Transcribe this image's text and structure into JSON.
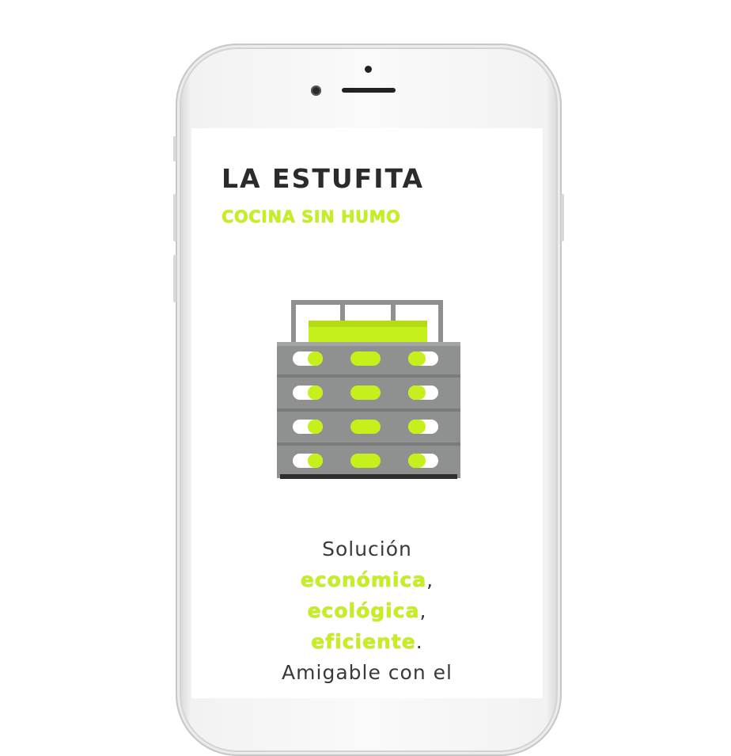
{
  "page": {
    "title": "LA ESTUFITA",
    "subtitle": "COCINA SIN HUMO"
  },
  "illustration": {
    "icon": "stove-icon",
    "accent_color": "#c6f01c"
  },
  "copy": {
    "intro": "Solución",
    "word1": "económica",
    "sep1": ",",
    "word2": "ecológica",
    "sep2": ",",
    "word3": "eficiente",
    "end": ".",
    "more": "Amigable con el"
  },
  "colors": {
    "accent": "#c6f01c",
    "title": "#2b2b2b",
    "stove_body": "#8f9090"
  }
}
